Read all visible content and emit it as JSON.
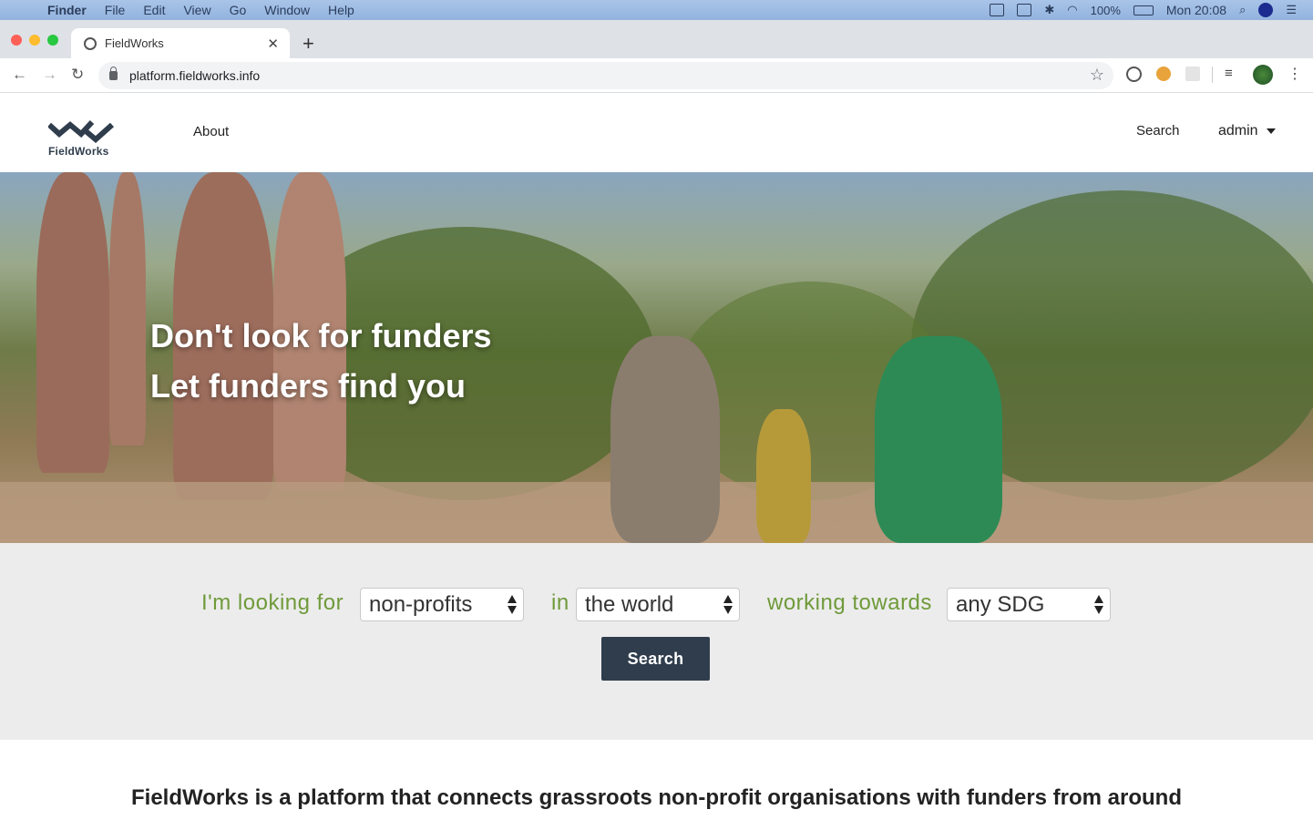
{
  "menubar": {
    "app": "Finder",
    "items": [
      "File",
      "Edit",
      "View",
      "Go",
      "Window",
      "Help"
    ],
    "battery": "100%",
    "clock": "Mon 20:08"
  },
  "browser": {
    "tab_title": "FieldWorks",
    "url": "platform.fieldworks.info"
  },
  "site": {
    "logo_text": "FieldWorks",
    "nav_about": "About",
    "nav_search": "Search",
    "nav_user": "admin"
  },
  "hero": {
    "line1": "Don't look for funders",
    "line2": "Let funders find you"
  },
  "search_form": {
    "label_looking": "I'm looking for",
    "select_type": "non-profits",
    "label_in": "in",
    "select_location": "the world",
    "label_working": "working towards",
    "select_sdg": "any SDG",
    "button": "Search"
  },
  "tagline": "FieldWorks is a platform that connects grassroots non-profit organisations with funders from around",
  "colors": {
    "brand_dark": "#2f3d4c",
    "label_green": "#6f9a3a",
    "band_gray": "#ececec"
  }
}
